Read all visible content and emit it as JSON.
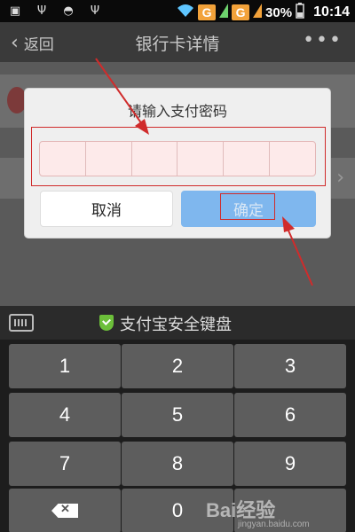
{
  "status_bar": {
    "network_badges": [
      "G",
      "G"
    ],
    "battery": "30%",
    "time": "10:14"
  },
  "header": {
    "back_label": "返回",
    "title": "银行卡详情",
    "more_label": "•••"
  },
  "dialog": {
    "title": "请输入支付密码",
    "password_digits": 6,
    "cancel_label": "取消",
    "confirm_label": "确定"
  },
  "keyboard": {
    "title": "支付宝安全键盘",
    "keys": [
      "1",
      "2",
      "3",
      "4",
      "5",
      "6",
      "7",
      "8",
      "9",
      "0"
    ]
  },
  "watermark": {
    "text": "Bai经验",
    "sub": "jingyan.baidu.com"
  },
  "colors": {
    "confirm_button": "#7fb7ee",
    "annotation": "#d02b2b",
    "shield": "#6cbf3a"
  }
}
